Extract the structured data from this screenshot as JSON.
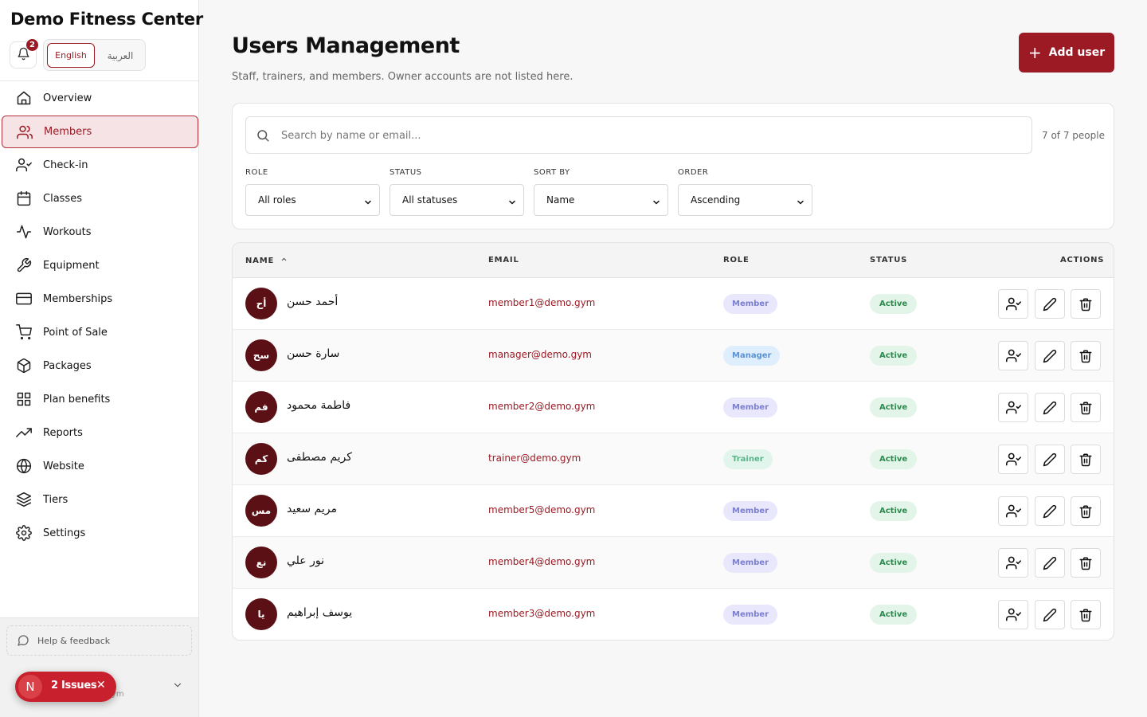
{
  "sidebar": {
    "brand": "Demo Fitness Center",
    "notification_count": "2",
    "lang_en": "English",
    "lang_ar": "العربية",
    "items": [
      {
        "label": "Overview",
        "icon": "home-icon"
      },
      {
        "label": "Members",
        "icon": "users-icon",
        "active": true
      },
      {
        "label": "Check-in",
        "icon": "user-check-icon"
      },
      {
        "label": "Classes",
        "icon": "calendar-icon"
      },
      {
        "label": "Workouts",
        "icon": "activity-icon"
      },
      {
        "label": "Equipment",
        "icon": "wrench-icon"
      },
      {
        "label": "Memberships",
        "icon": "credit-card-icon"
      },
      {
        "label": "Point of Sale",
        "icon": "shopping-cart-icon"
      },
      {
        "label": "Packages",
        "icon": "package-icon"
      },
      {
        "label": "Plan benefits",
        "icon": "grid-icon"
      },
      {
        "label": "Reports",
        "icon": "trending-up-icon"
      },
      {
        "label": "Website",
        "icon": "globe-icon"
      },
      {
        "label": "Tiers",
        "icon": "layers-icon"
      },
      {
        "label": "Settings",
        "icon": "settings-icon"
      }
    ],
    "help_label": "Help & feedback",
    "account_sub": "ym"
  },
  "issues": {
    "letter": "N",
    "label": "2 Issues",
    "close": "✕"
  },
  "header": {
    "title": "Users Management",
    "subtitle": "Staff, trainers, and members. Owner accounts are not listed here.",
    "add_button": "Add user"
  },
  "filters": {
    "search_placeholder": "Search by name or email...",
    "count": "7 of 7 people",
    "role_label": "ROLE",
    "role_value": "All roles",
    "status_label": "STATUS",
    "status_value": "All statuses",
    "sort_label": "SORT BY",
    "sort_value": "Name",
    "order_label": "ORDER",
    "order_value": "Ascending"
  },
  "table": {
    "columns": {
      "name": "NAME",
      "email": "EMAIL",
      "role": "ROLE",
      "status": "STATUS",
      "actions": "ACTIONS"
    },
    "rows": [
      {
        "initials": "أح",
        "name": "أحمد حسن",
        "email": "member1@demo.gym",
        "role": "Member",
        "status": "Active"
      },
      {
        "initials": "سح",
        "name": "سارة حسن",
        "email": "manager@demo.gym",
        "role": "Manager",
        "status": "Active"
      },
      {
        "initials": "فم",
        "name": "فاطمة محمود",
        "email": "member2@demo.gym",
        "role": "Member",
        "status": "Active"
      },
      {
        "initials": "كم",
        "name": "كريم مصطفى",
        "email": "trainer@demo.gym",
        "role": "Trainer",
        "status": "Active"
      },
      {
        "initials": "مس",
        "name": "مريم سعيد",
        "email": "member5@demo.gym",
        "role": "Member",
        "status": "Active"
      },
      {
        "initials": "نع",
        "name": "نور علي",
        "email": "member4@demo.gym",
        "role": "Member",
        "status": "Active"
      },
      {
        "initials": "يا",
        "name": "يوسف إبراهيم",
        "email": "member3@demo.gym",
        "role": "Member",
        "status": "Active"
      }
    ]
  },
  "colors": {
    "accent": "#9b1a24",
    "active_status": "#2d8a4e"
  }
}
